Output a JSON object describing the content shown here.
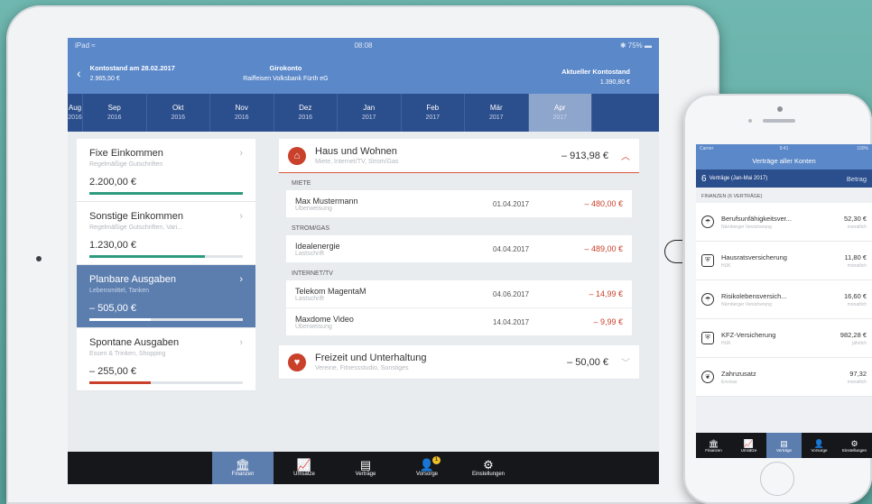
{
  "status": {
    "device": "iPad",
    "time": "08:08",
    "battery": "75%"
  },
  "header": {
    "left_label": "Kontostand am 28.02.2017",
    "left_value": "2.965,50 €",
    "center_title": "Girokonto",
    "center_bank": "Raiffeisen Volksbank Fürth eG",
    "right_label": "Aktueller Kontostand",
    "right_value": "1.390,80 €"
  },
  "months": [
    {
      "m": "Aug",
      "y": "2016"
    },
    {
      "m": "Sep",
      "y": "2016"
    },
    {
      "m": "Okt",
      "y": "2016"
    },
    {
      "m": "Nov",
      "y": "2016"
    },
    {
      "m": "Dez",
      "y": "2016"
    },
    {
      "m": "Jan",
      "y": "2017"
    },
    {
      "m": "Feb",
      "y": "2017"
    },
    {
      "m": "Mär",
      "y": "2017"
    },
    {
      "m": "Apr",
      "y": "2017"
    }
  ],
  "left_cards": [
    {
      "title": "Fixe Einkommen",
      "sub": "Regelmäßige Gutschriften",
      "value": "2.200,00 €",
      "progress": 1.0,
      "color": "#2e9b7f"
    },
    {
      "title": "Sonstige Einkommen",
      "sub": "Regelmäßige Gutschriften, Vari...",
      "value": "1.230,00 €",
      "progress": 0.75,
      "color": "#2e9b7f"
    },
    {
      "title": "Planbare Ausgaben",
      "sub": "Lebensmittel, Tanken",
      "value": "– 505,00 €",
      "progress": 0.4,
      "color": "#ffffff"
    },
    {
      "title": "Spontane Ausgaben",
      "sub": "Essen & Trinken, Shopping",
      "value": "– 255,00 €",
      "progress": 0.4,
      "color": "#c9412b"
    }
  ],
  "category1": {
    "title": "Haus und Wohnen",
    "sub": "Miete, Internet/TV, Strom/Gas",
    "amount": "– 913,98 €"
  },
  "sections": [
    {
      "name": "MIETE",
      "rows": [
        {
          "title": "Max Mustermann",
          "sub": "Überweisung",
          "date": "01.04.2017",
          "amount": "– 480,00 €"
        }
      ]
    },
    {
      "name": "STROM/GAS",
      "rows": [
        {
          "title": "Idealenergie",
          "sub": "Lastschrift",
          "date": "04.04.2017",
          "amount": "– 489,00 €"
        }
      ]
    },
    {
      "name": "INTERNET/TV",
      "rows": [
        {
          "title": "Telekom MagentaM",
          "sub": "Lastschrift",
          "date": "04.06.2017",
          "amount": "– 14,99 €"
        },
        {
          "title": "Maxdome Video",
          "sub": "Überweisung",
          "date": "14.04.2017",
          "amount": "– 9,99 €"
        }
      ]
    }
  ],
  "category2": {
    "title": "Freizeit und Unterhaltung",
    "sub": "Vereine, Fitnessstudio, Sonstiges",
    "amount": "– 50,00 €"
  },
  "tabs": [
    {
      "label": "Finanzen"
    },
    {
      "label": "Umsätze"
    },
    {
      "label": "Verträge"
    },
    {
      "label": "Vorsorge",
      "badge": "1"
    },
    {
      "label": "Einstellungen"
    }
  ],
  "phone": {
    "status": {
      "carrier": "Carrier",
      "time": "9:41",
      "battery": "100%"
    },
    "title": "Verträge aller Konten",
    "count": "6",
    "count_label": "Verträge (Jan-Mai 2017)",
    "sort_label": "Betrag",
    "section": "FINANZEN (6 VERTRÄGE)",
    "rows": [
      {
        "title": "Berufsunfähigkeitsver...",
        "sub": "Nürnberger Versicherung",
        "value": "52,30 €",
        "period": "monatlich"
      },
      {
        "title": "Hausratsversicherung",
        "sub": "HUK",
        "value": "11,80 €",
        "period": "monatlich"
      },
      {
        "title": "Risikolebensversich...",
        "sub": "Nürnberger Versicherung",
        "value": "16,60 €",
        "period": "monatlich"
      },
      {
        "title": "KFZ-Versicherung",
        "sub": "HUK",
        "value": "982,28 €",
        "period": "jährlich"
      },
      {
        "title": "Zahnzusatz",
        "sub": "Envivas",
        "value": "97,32",
        "period": "monatlich"
      }
    ],
    "tabs": [
      {
        "label": "Finanzen"
      },
      {
        "label": "Umsätze"
      },
      {
        "label": "Verträge"
      },
      {
        "label": "Vorsorge"
      },
      {
        "label": "Einstellungen"
      }
    ]
  }
}
